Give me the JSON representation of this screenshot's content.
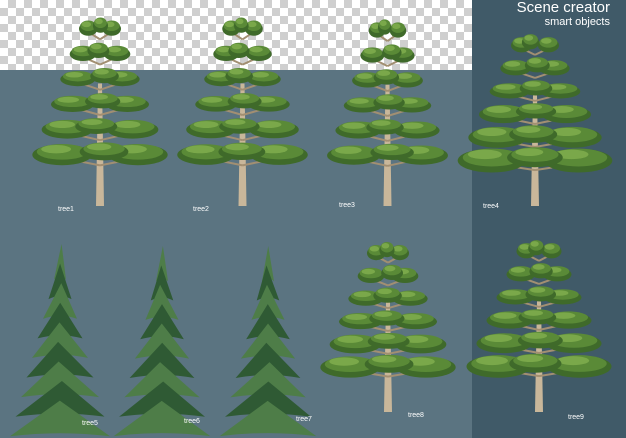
{
  "header": {
    "title": "Scene creator",
    "subtitle": "smart objects"
  },
  "trees": [
    {
      "label": "tree1",
      "kind": "pine-icon"
    },
    {
      "label": "tree2",
      "kind": "pine-icon"
    },
    {
      "label": "tree3",
      "kind": "pine-icon"
    },
    {
      "label": "tree4",
      "kind": "pine-icon"
    },
    {
      "label": "tree5",
      "kind": "fir-icon"
    },
    {
      "label": "tree6",
      "kind": "fir-icon"
    },
    {
      "label": "tree7",
      "kind": "fir-icon"
    },
    {
      "label": "tree8",
      "kind": "pine-icon"
    },
    {
      "label": "tree9",
      "kind": "pine-icon"
    }
  ],
  "colors": {
    "foliage_dark": "#3f6a2a",
    "foliage_mid": "#5a8a37",
    "foliage_light": "#7aa84a",
    "fir_dark": "#2f5a34",
    "fir_light": "#4e7d48",
    "trunk": "#c9b79a",
    "trunk_dark": "#a28f72"
  }
}
